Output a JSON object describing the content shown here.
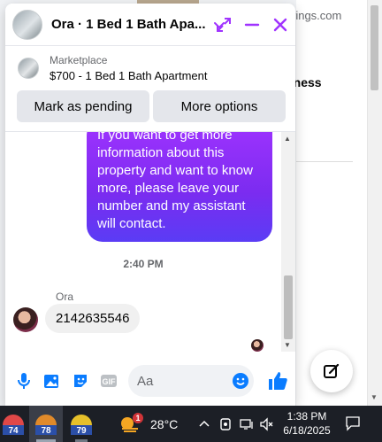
{
  "background": {
    "site_text": "rings.com",
    "heading_fragment": "siness"
  },
  "chat": {
    "title": "Ora · 1 Bed 1 Bath Apa...",
    "marketplace": {
      "label": "Marketplace",
      "listing": "$700 - 1 Bed 1 Bath Apartment"
    },
    "actions": {
      "mark_pending": "Mark as pending",
      "more_options": "More options"
    },
    "messages": {
      "outgoing_text": "If you want to get more information about this property and want to know more, please leave your number and my assistant will contact.",
      "timestamp": "2:40 PM",
      "sender_name": "Ora",
      "incoming_text": "2142635546"
    },
    "composer": {
      "placeholder": "Aa"
    },
    "colors": {
      "accent": "#a033ff",
      "like": "#0a7cff"
    }
  },
  "taskbar": {
    "app_badges": [
      "74",
      "78",
      "79"
    ],
    "weather_temp": "28°C",
    "weather_alert_count": "1",
    "time": "1:38 PM",
    "date": "6/18/2025"
  }
}
